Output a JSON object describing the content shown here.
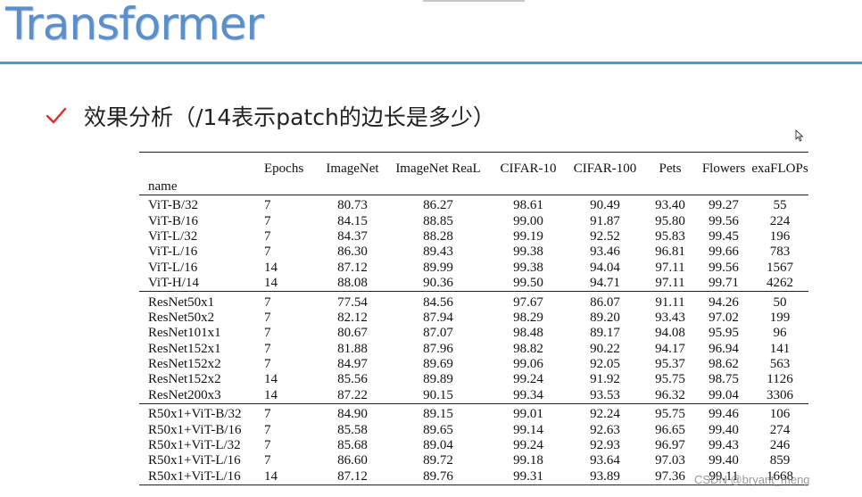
{
  "slide": {
    "title": "Transformer",
    "bullet": "效果分析（/14表示patch的边长是多少）"
  },
  "table": {
    "headers": [
      "",
      "Epochs",
      "ImageNet",
      "ImageNet ReaL",
      "CIFAR-10",
      "CIFAR-100",
      "Pets",
      "Flowers",
      "exaFLOPs"
    ],
    "row_header_label": "name",
    "groups": [
      [
        [
          "ViT-B/32",
          "7",
          "80.73",
          "86.27",
          "98.61",
          "90.49",
          "93.40",
          "99.27",
          "55"
        ],
        [
          "ViT-B/16",
          "7",
          "84.15",
          "88.85",
          "99.00",
          "91.87",
          "95.80",
          "99.56",
          "224"
        ],
        [
          "ViT-L/32",
          "7",
          "84.37",
          "88.28",
          "99.19",
          "92.52",
          "95.83",
          "99.45",
          "196"
        ],
        [
          "ViT-L/16",
          "7",
          "86.30",
          "89.43",
          "99.38",
          "93.46",
          "96.81",
          "99.66",
          "783"
        ],
        [
          "ViT-L/16",
          "14",
          "87.12",
          "89.99",
          "99.38",
          "94.04",
          "97.11",
          "99.56",
          "1567"
        ],
        [
          "ViT-H/14",
          "14",
          "88.08",
          "90.36",
          "99.50",
          "94.71",
          "97.11",
          "99.71",
          "4262"
        ]
      ],
      [
        [
          "ResNet50x1",
          "7",
          "77.54",
          "84.56",
          "97.67",
          "86.07",
          "91.11",
          "94.26",
          "50"
        ],
        [
          "ResNet50x2",
          "7",
          "82.12",
          "87.94",
          "98.29",
          "89.20",
          "93.43",
          "97.02",
          "199"
        ],
        [
          "ResNet101x1",
          "7",
          "80.67",
          "87.07",
          "98.48",
          "89.17",
          "94.08",
          "95.95",
          "96"
        ],
        [
          "ResNet152x1",
          "7",
          "81.88",
          "87.96",
          "98.82",
          "90.22",
          "94.17",
          "96.94",
          "141"
        ],
        [
          "ResNet152x2",
          "7",
          "84.97",
          "89.69",
          "99.06",
          "92.05",
          "95.37",
          "98.62",
          "563"
        ],
        [
          "ResNet152x2",
          "14",
          "85.56",
          "89.89",
          "99.24",
          "91.92",
          "95.75",
          "98.75",
          "1126"
        ],
        [
          "ResNet200x3",
          "14",
          "87.22",
          "90.15",
          "99.34",
          "93.53",
          "96.32",
          "99.04",
          "3306"
        ]
      ],
      [
        [
          "R50x1+ViT-B/32",
          "7",
          "84.90",
          "89.15",
          "99.01",
          "92.24",
          "95.75",
          "99.46",
          "106"
        ],
        [
          "R50x1+ViT-B/16",
          "7",
          "85.58",
          "89.65",
          "99.14",
          "92.63",
          "96.65",
          "99.40",
          "274"
        ],
        [
          "R50x1+ViT-L/32",
          "7",
          "85.68",
          "89.04",
          "99.24",
          "92.93",
          "96.97",
          "99.43",
          "246"
        ],
        [
          "R50x1+ViT-L/16",
          "7",
          "86.60",
          "89.72",
          "99.18",
          "93.64",
          "97.03",
          "99.40",
          "859"
        ],
        [
          "R50x1+ViT-L/16",
          "14",
          "87.12",
          "89.76",
          "99.31",
          "93.89",
          "97.36",
          "99.11",
          "1668"
        ]
      ]
    ]
  },
  "watermark": "CSDN @bryant_meng",
  "colors": {
    "title": "#5b8fc9",
    "rule": "#3ca6b4",
    "check": "#d9302c"
  },
  "icons": {
    "bullet": "checkmark-icon",
    "pointer": "mouse-cursor-icon"
  }
}
